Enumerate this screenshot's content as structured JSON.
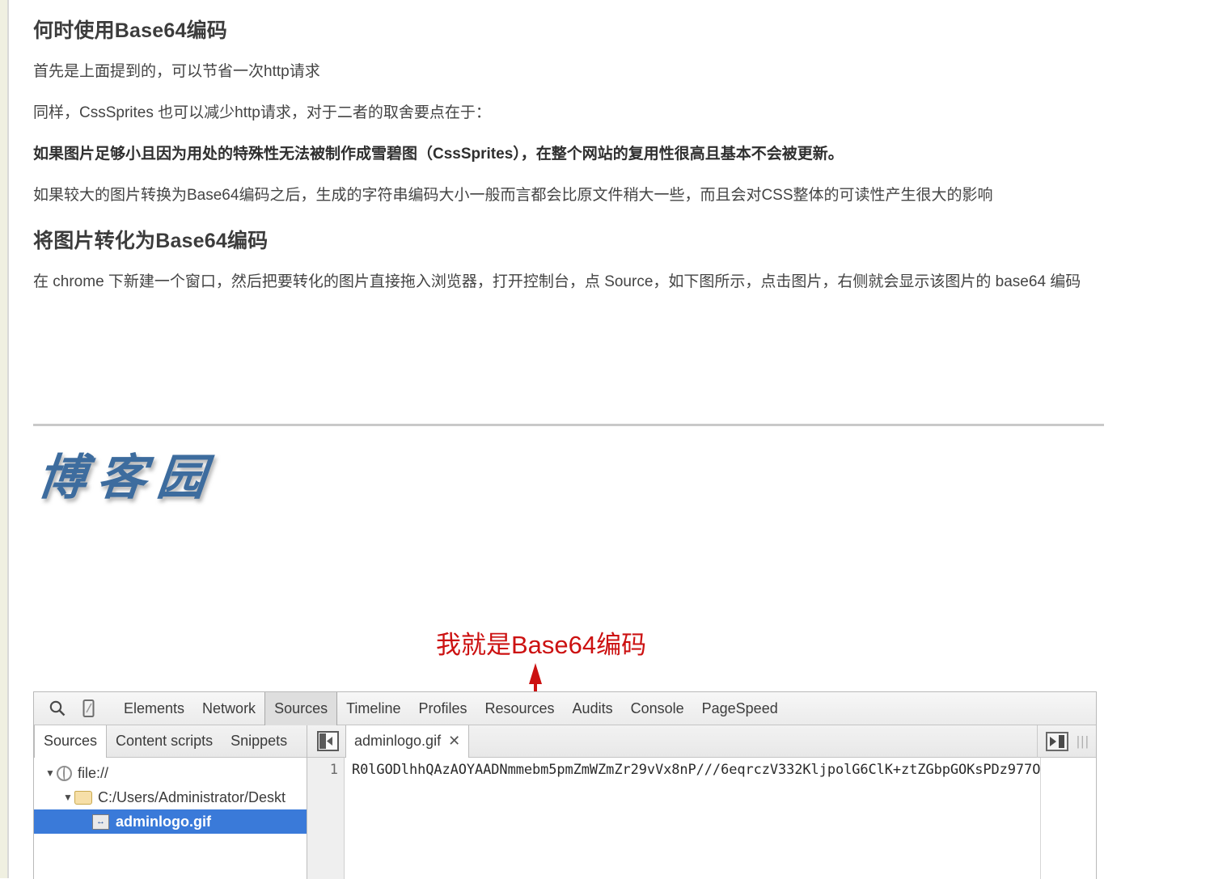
{
  "article": {
    "heading1": "何时使用Base64编码",
    "para1": "首先是上面提到的，可以节省一次http请求",
    "para2": "同样，CssSprites 也可以减少http请求，对于二者的取舍要点在于：",
    "para3_strong": "如果图片足够小且因为用处的特殊性无法被制作成雪碧图（CssSprites），在整个网站的复用性很高且基本不会被更新。",
    "para4": "如果较大的图片转换为Base64编码之后，生成的字符串编码大小一般而言都会比原文件稍大一些，而且会对CSS整体的可读性产生很大的影响",
    "heading2": "将图片转化为Base64编码",
    "para5": "在 chrome 下新建一个窗口，然后把要转化的图片直接拖入浏览器，打开控制台，点 Source，如下图所示，点击图片，右侧就会显示该图片的 base64 编码"
  },
  "figure": {
    "watermark": "博客园",
    "annotation": "我就是Base64编码",
    "annotation_color": "#cc1111"
  },
  "devtools": {
    "toolbar_icons": [
      "search-icon",
      "device-toolbar-icon"
    ],
    "tabs": [
      {
        "label": "Elements",
        "active": false
      },
      {
        "label": "Network",
        "active": false
      },
      {
        "label": "Sources",
        "active": true
      },
      {
        "label": "Timeline",
        "active": false
      },
      {
        "label": "Profiles",
        "active": false
      },
      {
        "label": "Resources",
        "active": false
      },
      {
        "label": "Audits",
        "active": false
      },
      {
        "label": "Console",
        "active": false
      },
      {
        "label": "PageSpeed",
        "active": false
      }
    ],
    "subtabs": [
      {
        "label": "Sources",
        "active": true
      },
      {
        "label": "Content scripts",
        "active": false
      },
      {
        "label": "Snippets",
        "active": false
      }
    ],
    "file_tab": {
      "label": "adminlogo.gif",
      "close": "✕"
    },
    "grip": "|||",
    "tree": [
      {
        "twisty": "▼",
        "icon": "globe-icon",
        "label": "file://",
        "depth": 0,
        "selected": false
      },
      {
        "twisty": "▼",
        "icon": "folder-icon",
        "label": "C:/Users/Administrator/Deskt",
        "depth": 1,
        "selected": false
      },
      {
        "twisty": "",
        "icon": "gif-file-icon",
        "label": "adminlogo.gif",
        "depth": 2,
        "selected": true
      }
    ],
    "source": {
      "line_number": "1",
      "code": "R0lGODlhhQAzAOYAADNmmebm5pmZmWZmZr29vVx8nP///6eqrczV332KljpolG6ClK+ztZGbpGOKsPDz977O"
    }
  }
}
